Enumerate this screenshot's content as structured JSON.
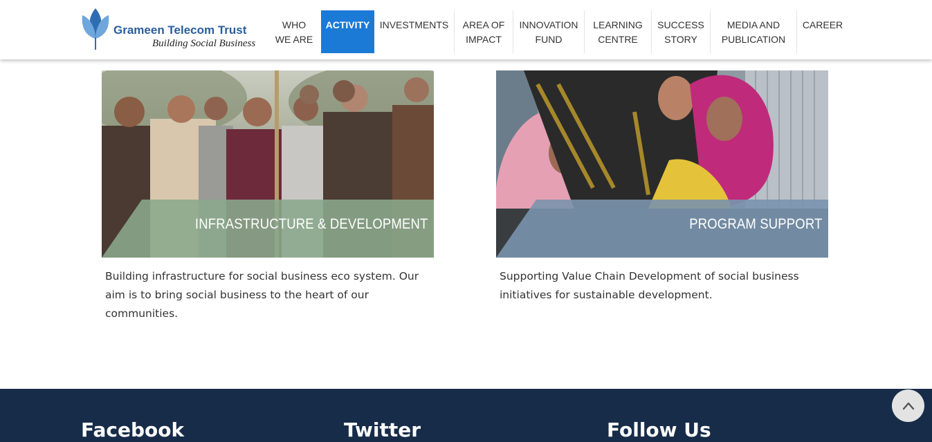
{
  "brand": {
    "name": "Grameen Telecom Trust",
    "tagline": "Building Social Business",
    "icon": "lotus-logo-icon"
  },
  "nav": {
    "active_color": "#1b7ad6",
    "items": [
      {
        "label": "WHO\nWE ARE"
      },
      {
        "label": "ACTIVITY",
        "active": true
      },
      {
        "label": "INVESTMENTS"
      },
      {
        "label": "AREA OF\nIMPACT"
      },
      {
        "label": "INNOVATION\nFUND"
      },
      {
        "label": "LEARNING\nCENTRE"
      },
      {
        "label": "SUCCESS\nSTORY"
      },
      {
        "label": "MEDIA AND\nPUBLICATION"
      },
      {
        "label": "CAREER"
      }
    ]
  },
  "cards": [
    {
      "title": "INFRASTRUCTURE & DEVELOPMENT",
      "description": "Building infrastructure for social business eco system. Our aim is to bring social business to the heart of our communities.",
      "banner_color": "#8aa98c"
    },
    {
      "title": "PROGRAM SUPPORT",
      "description": "Supporting Value Chain Development of social business initiatives for sustainable development.",
      "banner_color": "#7a93ad"
    }
  ],
  "footer": {
    "background": "#172c49",
    "headings": [
      "Facebook",
      "Twitter",
      "Follow Us"
    ]
  },
  "scroll_top": {
    "icon": "chevron-up-icon"
  }
}
